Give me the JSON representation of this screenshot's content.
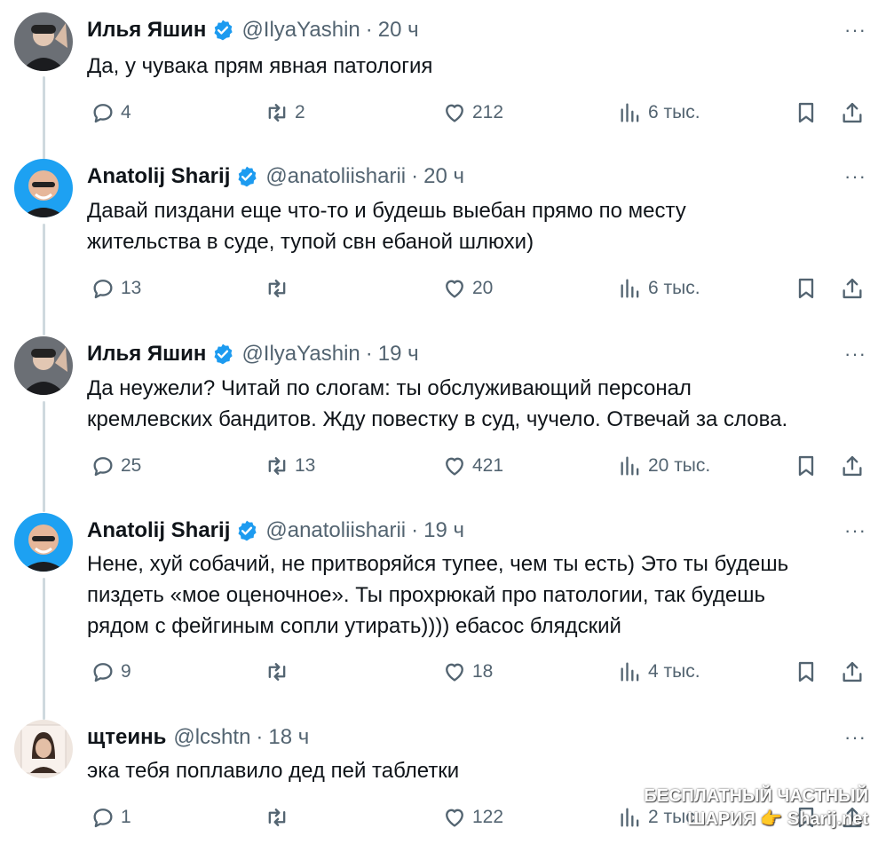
{
  "tweets": [
    {
      "name": "Илья Яшин",
      "handle": "@IlyaYashin",
      "sep": "·",
      "time": "20 ч",
      "verified": true,
      "avatar": "yashin",
      "lines": [
        "Да, у чувака прям явная патология"
      ],
      "replies": "4",
      "retweets": "2",
      "likes": "212",
      "views": "6 тыс."
    },
    {
      "name": "Anatolij Sharij",
      "handle": "@anatoliisharii",
      "sep": "·",
      "time": "20 ч",
      "verified": true,
      "avatar": "sharij",
      "lines": [
        "Давай пиздани еще что-то и будешь выебан прямо по месту",
        "жительства в суде, тупой свн ебаной шлюхи)"
      ],
      "replies": "13",
      "retweets": "",
      "likes": "20",
      "views": "6 тыс."
    },
    {
      "name": "Илья Яшин",
      "handle": "@IlyaYashin",
      "sep": "·",
      "time": "19 ч",
      "verified": true,
      "avatar": "yashin",
      "lines": [
        "Да неужели? Читай по слогам: ты обслуживающий персонал",
        "кремлевских бандитов. Жду повестку в суд, чучело. Отвечай за слова."
      ],
      "replies": "25",
      "retweets": "13",
      "likes": "421",
      "views": "20 тыс."
    },
    {
      "name": "Anatolij Sharij",
      "handle": "@anatoliisharii",
      "sep": "·",
      "time": "19 ч",
      "verified": true,
      "avatar": "sharij",
      "lines": [
        "Нене, хуй собачий, не притворяйся тупее, чем ты есть) Это ты будешь",
        "пиздеть «мое оценочное». Ты прохрюкай про патологии, так будешь",
        "рядом с фейгиным сопли утирать)))) ебасос блядский"
      ],
      "replies": "9",
      "retweets": "",
      "likes": "18",
      "views": "4 тыс."
    },
    {
      "name": "щтеинь",
      "handle": "@lcshtn",
      "sep": "·",
      "time": "18 ч",
      "verified": false,
      "avatar": "lcshtn",
      "lines": [
        "эка тебя поплавило дед пей таблетки"
      ],
      "replies": "1",
      "retweets": "",
      "likes": "122",
      "views": "2 тыс."
    }
  ],
  "more_label": "···",
  "watermark": [
    "БЕСПЛАТНЫЙ ЧАСТНЫЙ",
    "ШАРИЯ 👉 Sharij.net"
  ],
  "colors": {
    "verified": "#1d9bf0",
    "muted": "#536471",
    "thread": "#cfd9de",
    "text": "#0f1419"
  }
}
